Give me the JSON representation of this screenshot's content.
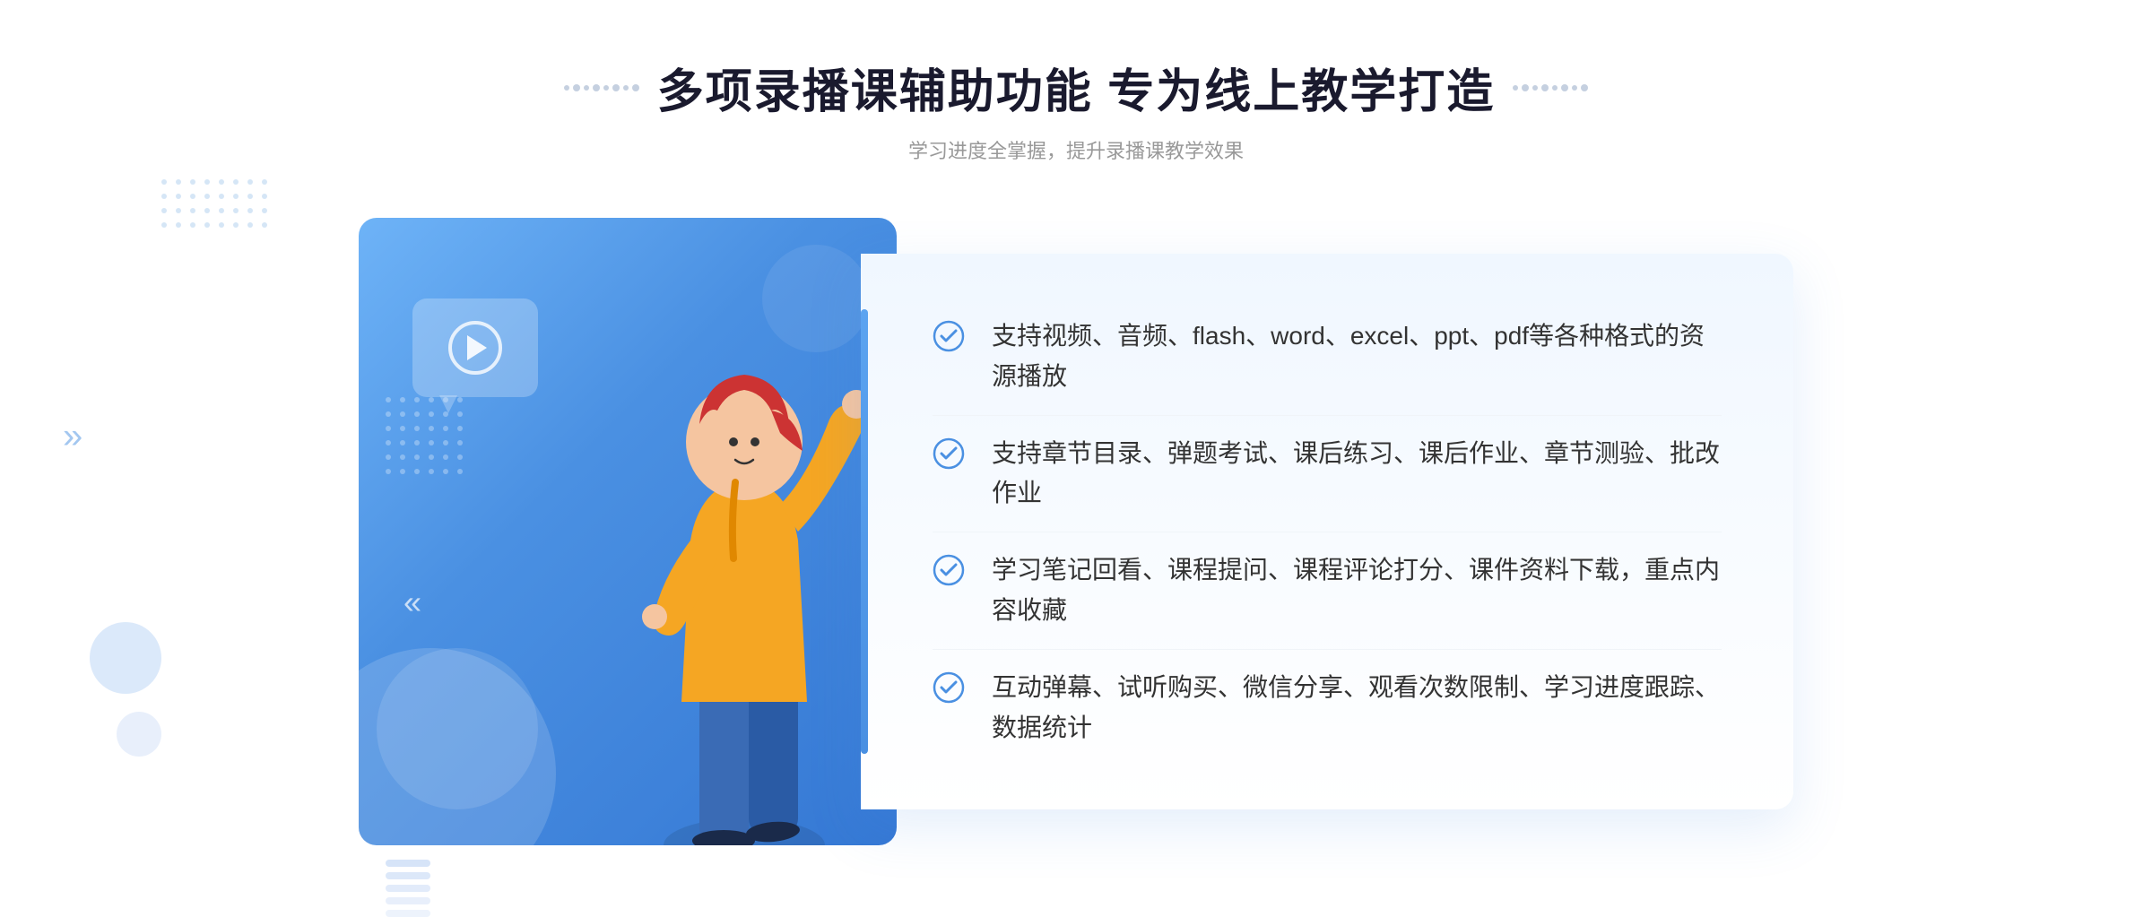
{
  "page": {
    "background": "#ffffff"
  },
  "header": {
    "title": "多项录播课辅助功能 专为线上教学打造",
    "subtitle": "学习进度全掌握，提升录播课教学效果",
    "dots_left": [
      "·",
      "·",
      "·",
      "·"
    ],
    "dots_right": [
      "·",
      "·",
      "·",
      "·"
    ]
  },
  "features": [
    {
      "id": 1,
      "text": "支持视频、音频、flash、word、excel、ppt、pdf等各种格式的资源播放"
    },
    {
      "id": 2,
      "text": "支持章节目录、弹题考试、课后练习、课后作业、章节测验、批改作业"
    },
    {
      "id": 3,
      "text": "学习笔记回看、课程提问、课程评论打分、课件资料下载，重点内容收藏"
    },
    {
      "id": 4,
      "text": "互动弹幕、试听购买、微信分享、观看次数限制、学习进度跟踪、数据统计"
    }
  ],
  "illustration": {
    "play_icon": "▶",
    "alt": "教学插图"
  },
  "colors": {
    "primary": "#4a90e2",
    "title": "#1a1a2e",
    "subtitle": "#999999",
    "feature_text": "#333333",
    "check_color": "#4a90e2",
    "bg_gradient_start": "#6eb3f7",
    "bg_gradient_end": "#3578d4"
  }
}
